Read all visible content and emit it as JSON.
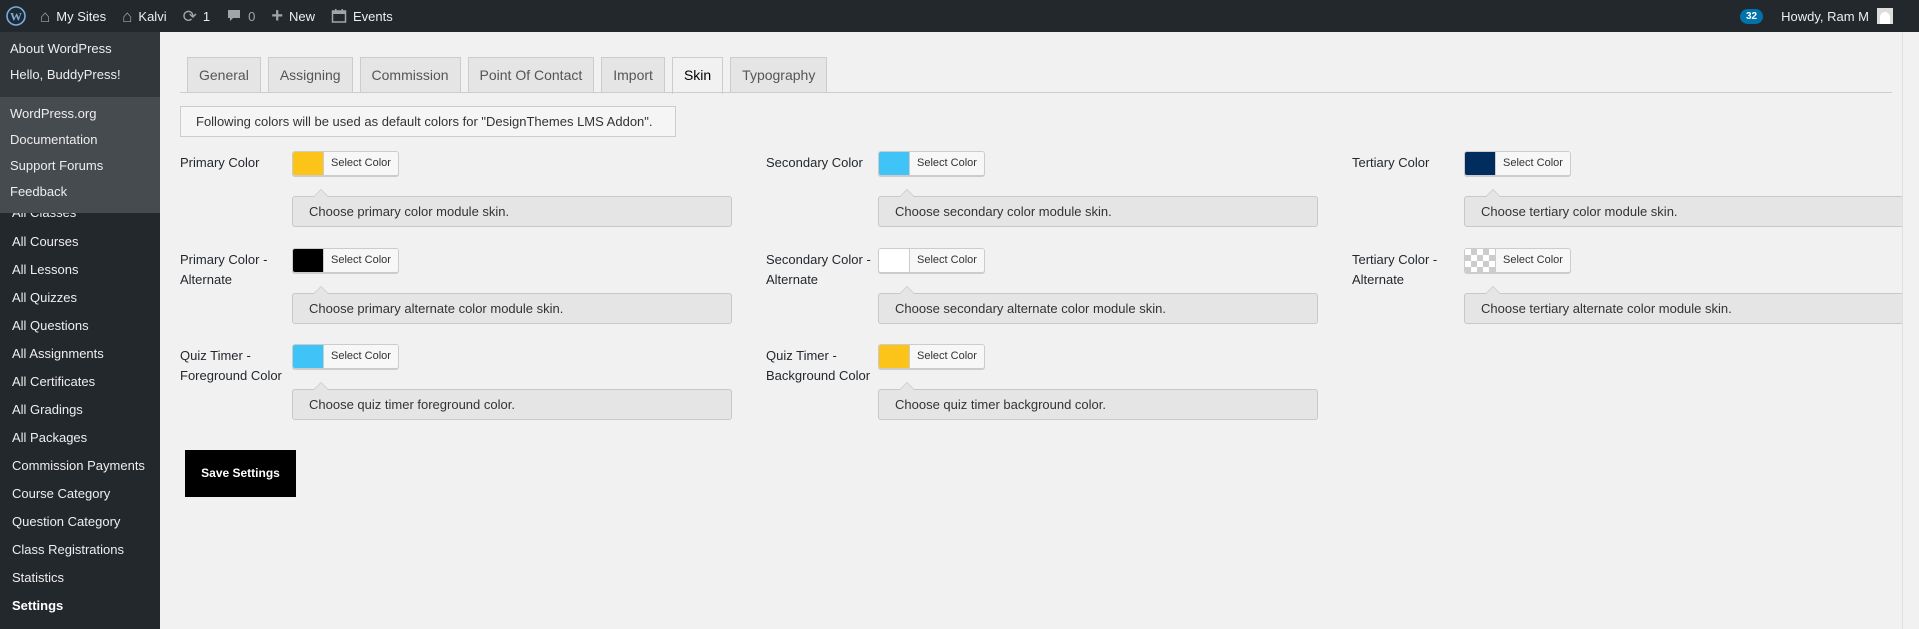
{
  "adminbar": {
    "my_sites": "My Sites",
    "site_name": "Kalvi",
    "updates_count": "1",
    "comments_count": "0",
    "new_label": "New",
    "events_label": "Events",
    "notification_count": "32",
    "howdy": "Howdy, Ram M"
  },
  "wp_dropdown": {
    "top": [
      "About WordPress",
      "Hello, BuddyPress!"
    ],
    "bottom": [
      "WordPress.org",
      "Documentation",
      "Support Forums",
      "Feedback"
    ]
  },
  "sidebar": {
    "items": [
      "All Classes",
      "All Courses",
      "All Lessons",
      "All Quizzes",
      "All Questions",
      "All Assignments",
      "All Certificates",
      "All Gradings",
      "All Packages",
      "Commission Payments",
      "Course Category",
      "Question Category",
      "Class Registrations",
      "Statistics",
      "Settings"
    ]
  },
  "tabs": [
    "General",
    "Assigning",
    "Commission",
    "Point Of Contact",
    "Import",
    "Skin",
    "Typography"
  ],
  "notice": "Following colors will be used as default colors for \"DesignThemes LMS Addon\".",
  "select_color_label": "Select Color",
  "fields": {
    "primary": {
      "label": "Primary Color",
      "desc": "Choose primary color module skin.",
      "color": "#fcc419"
    },
    "secondary": {
      "label": "Secondary Color",
      "desc": "Choose secondary color module skin.",
      "color": "#40c4f8"
    },
    "tertiary": {
      "label": "Tertiary Color",
      "desc": "Choose tertiary color module skin.",
      "color": "#002c5e"
    },
    "primary_alt": {
      "label": "Primary Color - Alternate",
      "desc": "Choose primary alternate color module skin.",
      "color": "#000000"
    },
    "secondary_alt": {
      "label": "Secondary Color - Alternate",
      "desc": "Choose secondary alternate color module skin.",
      "color": "#ffffff"
    },
    "tertiary_alt": {
      "label": "Tertiary Color - Alternate",
      "desc": "Choose tertiary alternate color module skin.",
      "color": "transparent"
    },
    "quiz_fg": {
      "label": "Quiz Timer - Foreground Color",
      "desc": "Choose quiz timer foreground color.",
      "color": "#40c4f8"
    },
    "quiz_bg": {
      "label": "Quiz Timer - Background Color",
      "desc": "Choose quiz timer background color.",
      "color": "#fcc419"
    }
  },
  "save_label": "Save Settings"
}
